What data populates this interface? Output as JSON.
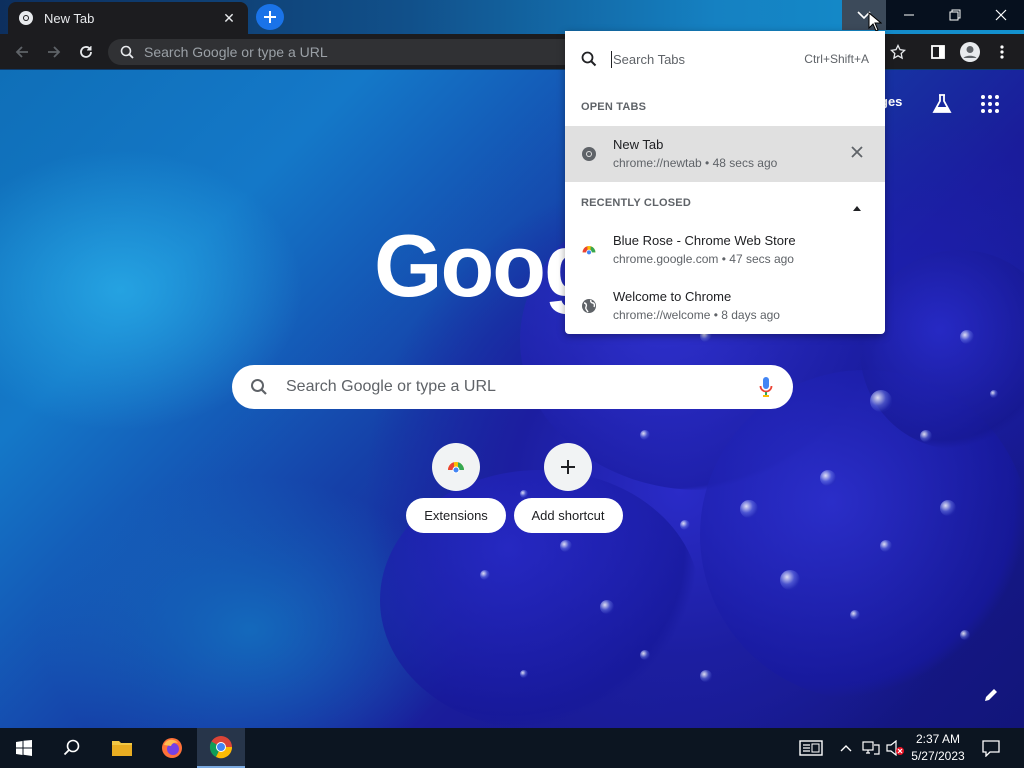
{
  "browser": {
    "tab_title": "New Tab",
    "omnibox_placeholder": "Search Google or type a URL"
  },
  "ntp": {
    "logo_text": "Goog",
    "top_link_images": "ges",
    "search_placeholder": "Search Google or type a URL",
    "shortcuts": [
      {
        "label": "Extensions"
      },
      {
        "label": "Add shortcut"
      }
    ]
  },
  "tab_search": {
    "placeholder": "Search Tabs",
    "shortcut_hint": "Ctrl+Shift+A",
    "open_tabs_header": "OPEN TABS",
    "open_tabs": [
      {
        "title": "New Tab",
        "url": "chrome://newtab",
        "age": "48 secs ago"
      }
    ],
    "recently_closed_header": "RECENTLY CLOSED",
    "recently_closed": [
      {
        "title": "Blue Rose - Chrome Web Store",
        "url": "chrome.google.com",
        "age": "47 secs ago"
      },
      {
        "title": "Welcome to Chrome",
        "url": "chrome://welcome",
        "age": "8 days ago"
      }
    ]
  },
  "taskbar": {
    "time": "2:37 AM",
    "date": "5/27/2023"
  },
  "colors": {
    "accent": "#1a73e8",
    "toolbar": "#1c1c1f",
    "highlight_row": "#e0e0e0"
  }
}
